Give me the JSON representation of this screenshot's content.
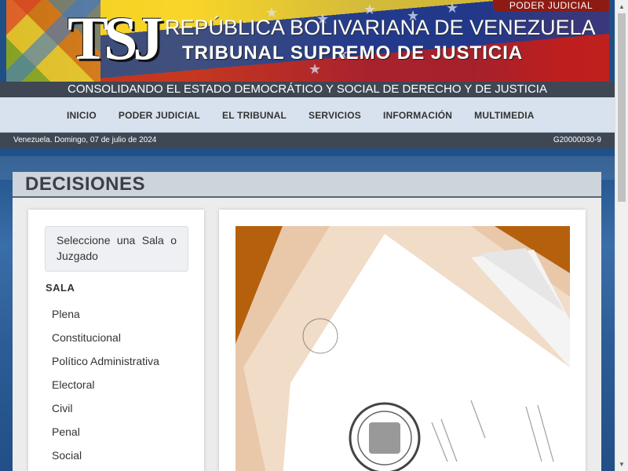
{
  "header": {
    "line1": "REPÚBLICA BOLIVARIANA DE VENEZUELA",
    "line2": "TRIBUNAL SUPREMO DE JUSTICIA",
    "logo_text": "TSJ",
    "badge": "PODER JUDICIAL"
  },
  "slogan": "CONSOLIDANDO EL ESTADO DEMOCRÁTICO Y SOCIAL DE DERECHO Y DE JUSTICIA",
  "nav": {
    "items": [
      {
        "label": "INICIO"
      },
      {
        "label": "PODER JUDICIAL"
      },
      {
        "label": "EL TRIBUNAL"
      },
      {
        "label": "SERVICIOS"
      },
      {
        "label": "INFORMACIÓN"
      },
      {
        "label": "MULTIMEDIA"
      }
    ]
  },
  "datebar": {
    "date": "Venezuela. Domingo, 07 de julio de 2024",
    "code": "G20000030-9"
  },
  "decisions": {
    "title": "DECISIONES",
    "select_prompt": "Seleccione una Sala o Juzgado",
    "sala_heading": "SALA",
    "salas": [
      {
        "label": "Plena"
      },
      {
        "label": "Constitucional"
      },
      {
        "label": "Político Administrativa"
      },
      {
        "label": "Electoral"
      },
      {
        "label": "Civil"
      },
      {
        "label": "Penal"
      },
      {
        "label": "Social"
      }
    ]
  },
  "colors": {
    "nav_bg": "#d8e2ee",
    "bar_dark": "#3e4753",
    "page_bg": "#1f4f86",
    "badge": "#8d1b14"
  }
}
